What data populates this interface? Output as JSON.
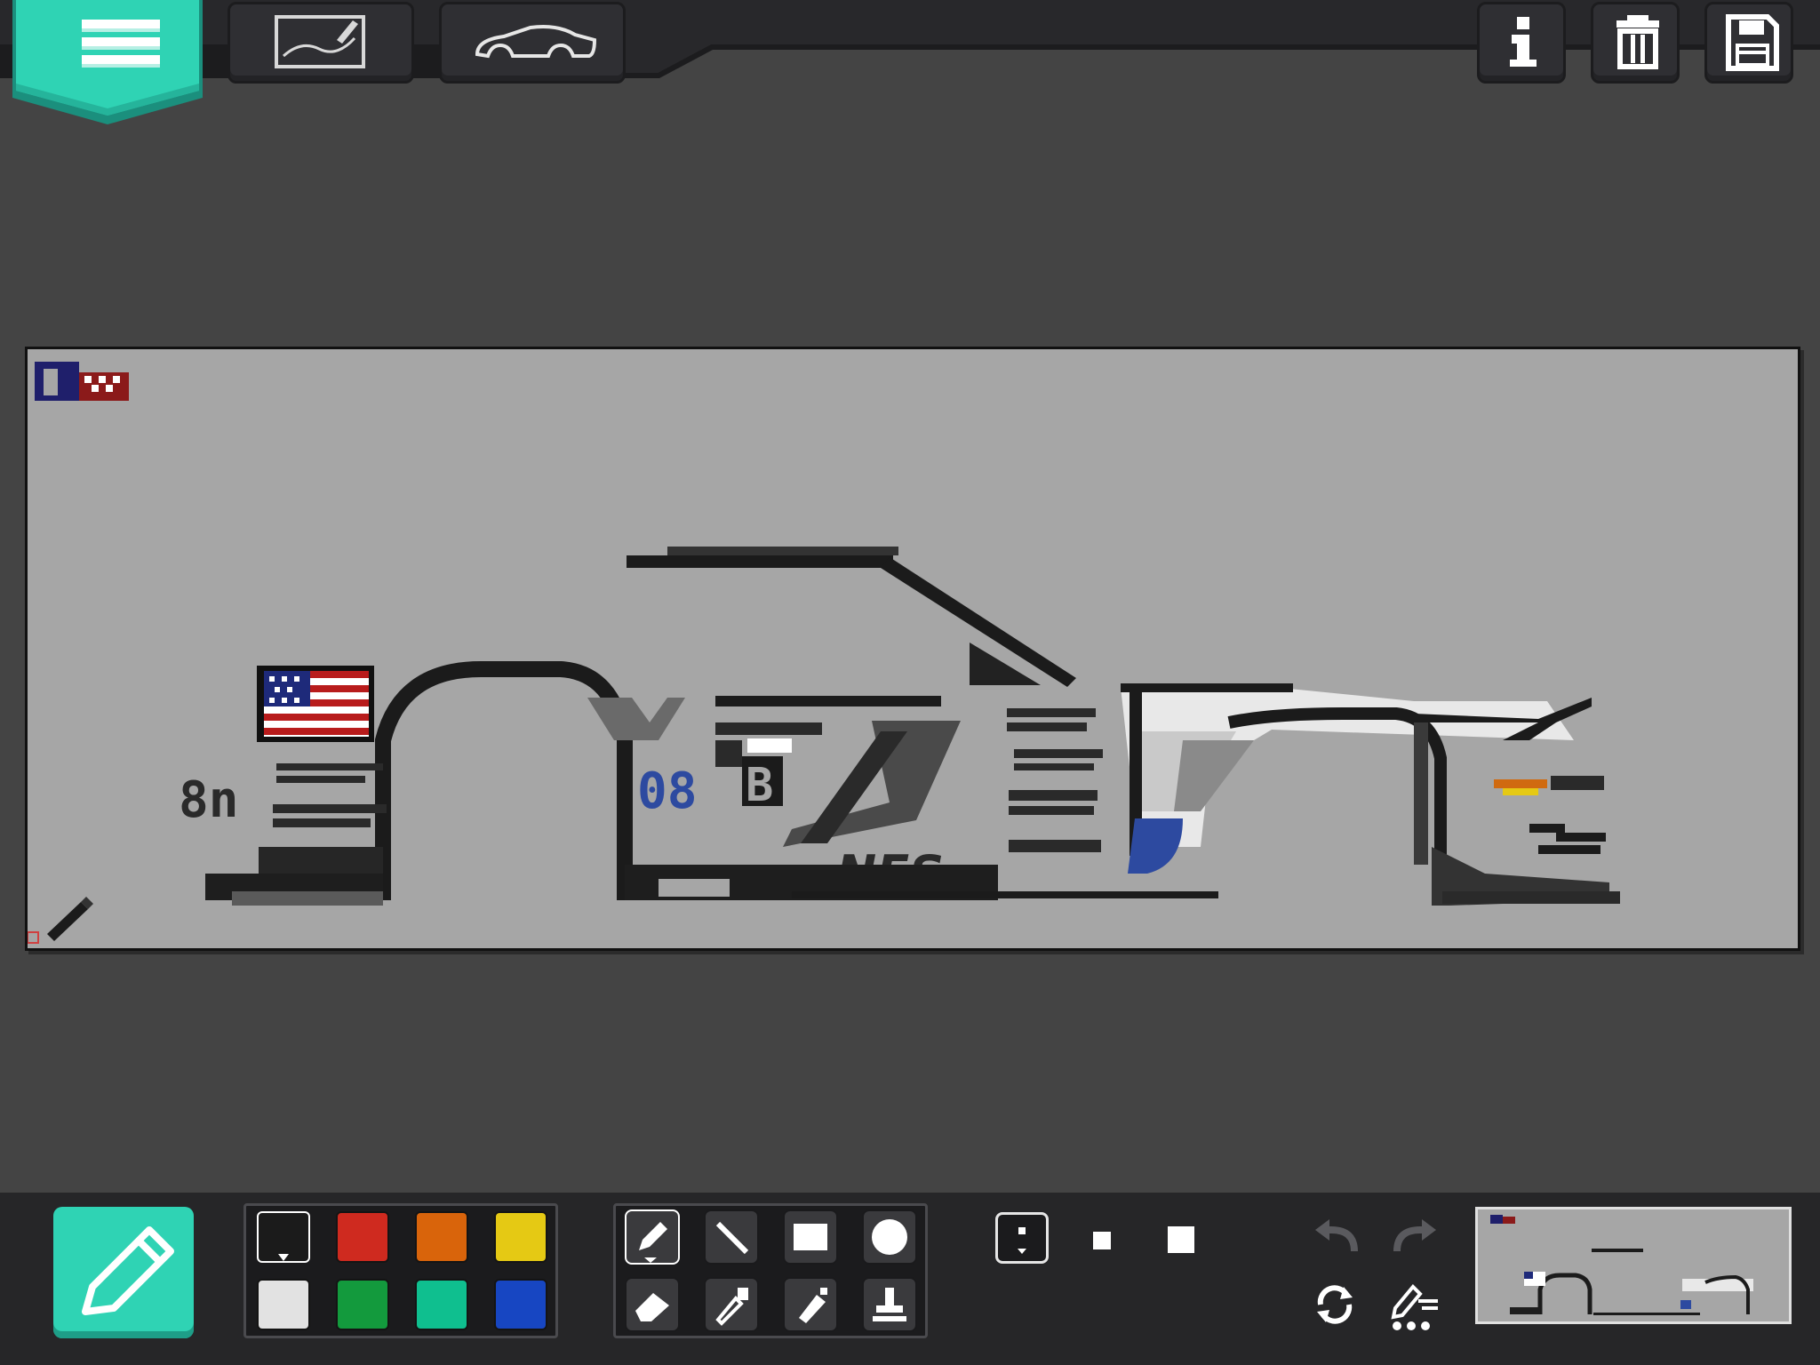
{
  "toolbar": {
    "menu_icon": "hamburger-menu-icon",
    "draw_mode_icon": "pen-on-canvas-icon",
    "car_mode_icon": "car-outline-icon",
    "info_icon": "info-icon",
    "delete_icon": "trash-icon",
    "save_icon": "floppy-disk-icon"
  },
  "colors": {
    "accent": "#2fd3b4",
    "background": "#444444",
    "canvas": "#a6a6a6",
    "panel": "#262628"
  },
  "palette": [
    {
      "name": "black",
      "hex": "#1b1b1b",
      "selected": true
    },
    {
      "name": "red",
      "hex": "#cf2a1f"
    },
    {
      "name": "orange",
      "hex": "#d9640b"
    },
    {
      "name": "yellow",
      "hex": "#e5c914"
    },
    {
      "name": "white",
      "hex": "#e2e2e2"
    },
    {
      "name": "green",
      "hex": "#139a3d"
    },
    {
      "name": "teal",
      "hex": "#0fbf8f"
    },
    {
      "name": "blue",
      "hex": "#1746c2"
    }
  ],
  "tools": [
    {
      "name": "pencil",
      "selected": true
    },
    {
      "name": "line"
    },
    {
      "name": "rectangle"
    },
    {
      "name": "circle"
    },
    {
      "name": "eraser"
    },
    {
      "name": "eyedropper"
    },
    {
      "name": "spray"
    },
    {
      "name": "stamp"
    }
  ],
  "brush_sizes": [
    {
      "name": "small",
      "selected": true
    },
    {
      "name": "medium"
    },
    {
      "name": "large"
    }
  ],
  "canvas": {
    "cursor_icon": "pencil-cursor-icon",
    "decals": {
      "number_left": "8n",
      "number_mid": "08",
      "brand": "NFS",
      "letter_b": "B"
    }
  }
}
